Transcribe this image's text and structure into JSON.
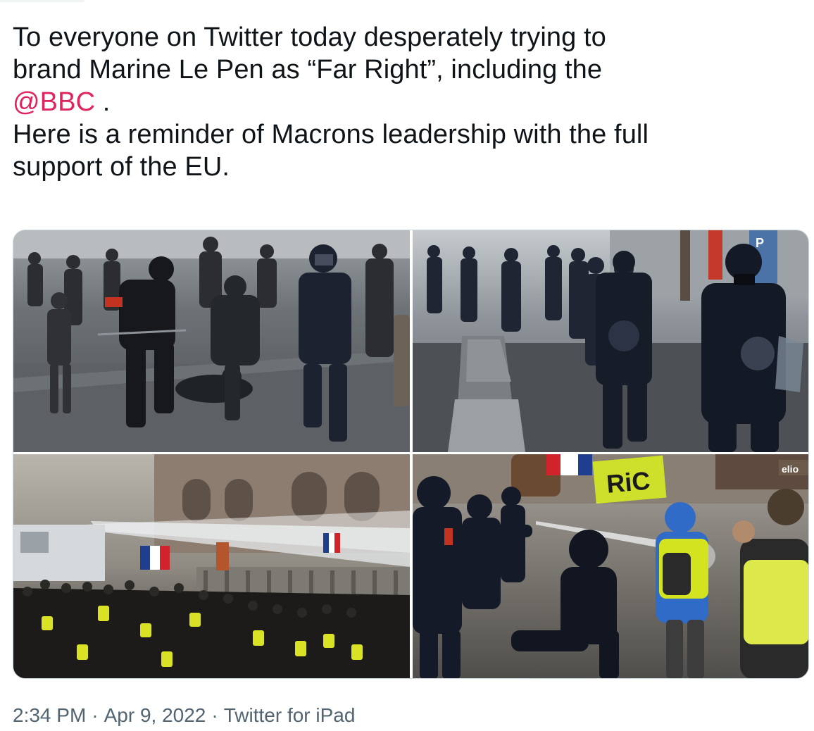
{
  "tweet": {
    "text_line1": "To everyone on Twitter today desperately trying to",
    "text_line2": "brand Marine Le Pen as “Far Right”, including the",
    "mention": "@BBC",
    "mention_suffix": " .",
    "text_line4": "Here is a reminder of Macrons leadership with the full",
    "text_line5": "support of the EU.",
    "mention_color": "#e0245e"
  },
  "media": {
    "photos": [
      {
        "alt": "photo-police-arrest"
      },
      {
        "alt": "photo-riot-police-march"
      },
      {
        "alt": "photo-water-cannon-crowd"
      },
      {
        "alt": "photo-pepper-spray-protest",
        "sign_text": "RiC"
      }
    ]
  },
  "meta": {
    "time": "2:34 PM",
    "date": "Apr 9, 2022",
    "source": "Twitter for iPad",
    "separator": "·"
  }
}
